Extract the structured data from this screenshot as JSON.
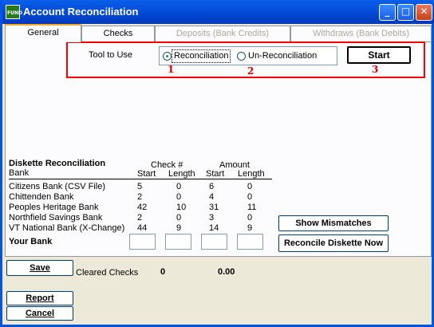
{
  "window": {
    "title": "Account Reconciliation",
    "icon_text": "FUND",
    "buttons": [
      "minimize-icon",
      "maximize-icon",
      "close-icon"
    ]
  },
  "tabs": [
    {
      "label": "General",
      "active": true,
      "enabled": true
    },
    {
      "label": "Checks",
      "active": false,
      "enabled": true
    },
    {
      "label": "Deposits (Bank Credits)",
      "active": false,
      "enabled": false
    },
    {
      "label": "Withdraws (Bank Debits)",
      "active": false,
      "enabled": false
    }
  ],
  "tool": {
    "label": "Tool to Use",
    "options": [
      "Reconciliation",
      "Un-Reconciliation"
    ],
    "selected": "Reconciliation",
    "start_label": "Start"
  },
  "callouts": [
    "1",
    "2",
    "3"
  ],
  "diskette": {
    "title": "Diskette Reconciliation",
    "bank_header": "Bank",
    "check_group": "Check #",
    "amount_group": "Amount",
    "start_header": "Start",
    "length_header": "Length",
    "rows": [
      {
        "bank": "Citizens Bank (CSV File)",
        "check_start": "5",
        "check_length": "0",
        "amount_start": "6",
        "amount_length": "0"
      },
      {
        "bank": "Chittenden Bank",
        "check_start": "2",
        "check_length": "0",
        "amount_start": "4",
        "amount_length": "0"
      },
      {
        "bank": "Peoples Heritage Bank",
        "check_start": "42",
        "check_length": "10",
        "amount_start": "31",
        "amount_length": "11"
      },
      {
        "bank": "Northfield Savings Bank",
        "check_start": "2",
        "check_length": "0",
        "amount_start": "3",
        "amount_length": "0"
      },
      {
        "bank": "VT National Bank (X-Change)",
        "check_start": "44",
        "check_length": "9",
        "amount_start": "14",
        "amount_length": "9"
      }
    ],
    "your_bank_label": "Your Bank",
    "your_bank_values": [
      "",
      "",
      "",
      ""
    ],
    "show_mismatches_label": "Show Mismatches",
    "reconcile_label": "Reconcile Diskette Now"
  },
  "footer": {
    "save_label": "Save",
    "cleared_label": "Cleared Checks",
    "cleared_count": "0",
    "cleared_amount": "0.00",
    "report_label": "Report",
    "cancel_label": "Cancel"
  }
}
